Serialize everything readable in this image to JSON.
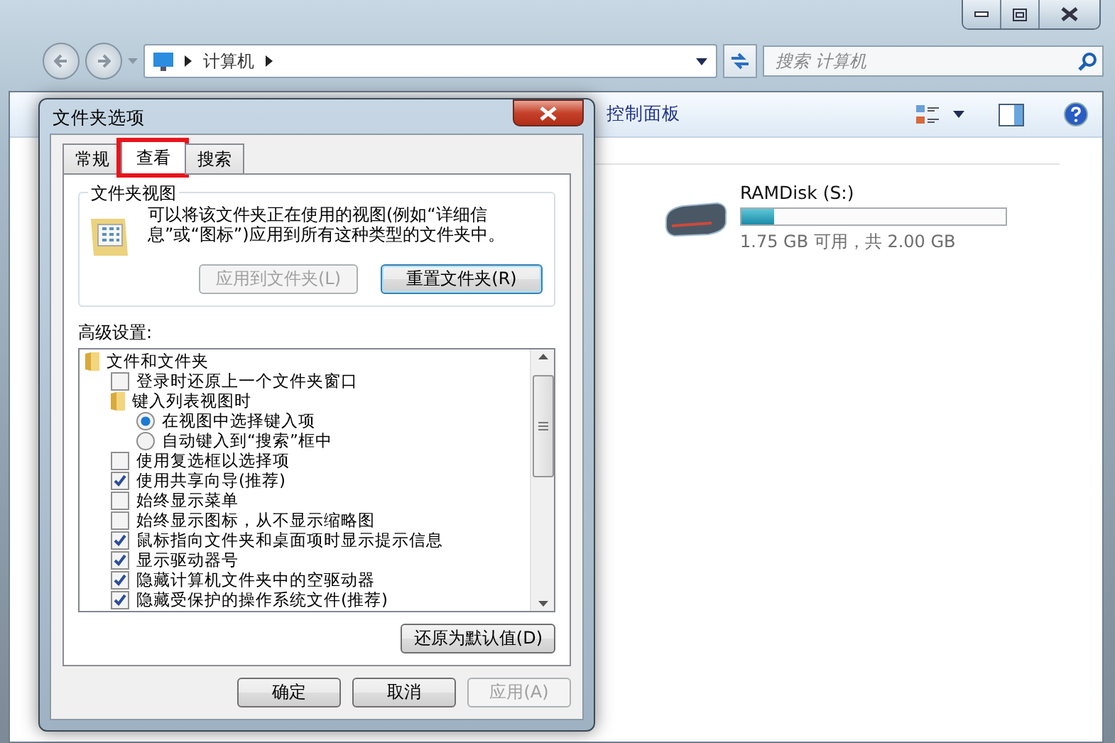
{
  "explorer": {
    "breadcrumb": "计算机",
    "search": {
      "placeholder": "搜索 计算机"
    },
    "toolbar_text": "控制面板",
    "drive": {
      "name": "RAMDisk (S:)",
      "level": 0.125,
      "free": "1.75 GB 可用，共 2.00 GB"
    }
  },
  "dialog": {
    "title": "文件夹选项",
    "tabs": [
      {
        "label": "常规",
        "selected": false
      },
      {
        "label": "查看",
        "selected": true,
        "highlighted": true
      },
      {
        "label": "搜索",
        "selected": false
      }
    ],
    "folder_view": {
      "title": "文件夹视图",
      "text": "可以将该文件夹正在使用的视图(例如“详细信息”或“图标”)应用到所有这种类型的文件夹中。",
      "buttons": [
        {
          "label": "应用到文件夹(L)",
          "disabled": true
        },
        {
          "label": "重置文件夹(R)",
          "disabled": false
        }
      ]
    },
    "advanced_label": "高级设置:",
    "tree": [
      {
        "kind": "folder",
        "label": "文件和文件夹",
        "children": [
          {
            "kind": "checkbox",
            "label": "登录时还原上一个文件夹窗口",
            "checked": false
          },
          {
            "kind": "folder",
            "label": "键入列表视图时",
            "children": [
              {
                "kind": "radio",
                "label": "在视图中选择键入项",
                "selected": true
              },
              {
                "kind": "radio",
                "label": "自动键入到“搜索”框中",
                "selected": false
              }
            ]
          },
          {
            "kind": "checkbox",
            "label": "使用复选框以选择项",
            "checked": false
          },
          {
            "kind": "checkbox",
            "label": "使用共享向导(推荐)",
            "checked": true
          },
          {
            "kind": "checkbox",
            "label": "始终显示菜单",
            "checked": false
          },
          {
            "kind": "checkbox",
            "label": "始终显示图标，从不显示缩略图",
            "checked": false
          },
          {
            "kind": "checkbox",
            "label": "鼠标指向文件夹和桌面项时显示提示信息",
            "checked": true
          },
          {
            "kind": "checkbox",
            "label": "显示驱动器号",
            "checked": true
          },
          {
            "kind": "checkbox",
            "label": "隐藏计算机文件夹中的空驱动器",
            "checked": true
          },
          {
            "kind": "checkbox",
            "label": "隐藏受保护的操作系统文件(推荐)",
            "checked": true
          }
        ]
      }
    ],
    "restore_button": {
      "label": "还原为默认值(D)",
      "disabled": false
    },
    "buttons": [
      {
        "label": "确定",
        "disabled": false
      },
      {
        "label": "取消",
        "disabled": false
      },
      {
        "label": "应用(A)",
        "disabled": true
      }
    ]
  }
}
